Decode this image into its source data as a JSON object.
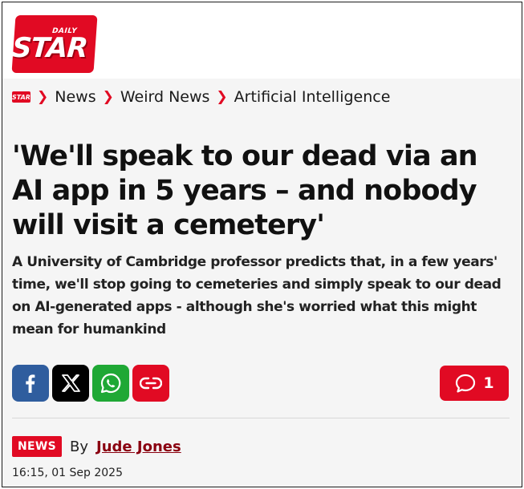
{
  "brand": {
    "small": "DAILY",
    "name": "STAR",
    "accent": "#e10a23"
  },
  "breadcrumb": {
    "home_logo": "STAR",
    "items": [
      "News",
      "Weird News",
      "Artificial Intelligence"
    ]
  },
  "article": {
    "headline": "'We'll speak to our dead via an AI app in 5 years – and nobody will visit a cemetery'",
    "standfirst": "A University of Cambridge professor predicts that, in a few years' time, we'll stop going to cemeteries and simply speak to our dead on AI-generated apps - although she's worried what this might mean for humankind",
    "share_buttons": [
      {
        "icon": "facebook-icon",
        "color": "#2f5d9e"
      },
      {
        "icon": "x-icon",
        "color": "#000000"
      },
      {
        "icon": "whatsapp-icon",
        "color": "#1fa835"
      },
      {
        "icon": "link-icon",
        "color": "#e10a23"
      }
    ],
    "comments": {
      "icon": "comment-icon",
      "count": "1"
    },
    "byline": {
      "badge": "NEWS",
      "by": "By",
      "author": "Jude Jones"
    },
    "timestamp": "16:15, 01 Sep 2025"
  }
}
